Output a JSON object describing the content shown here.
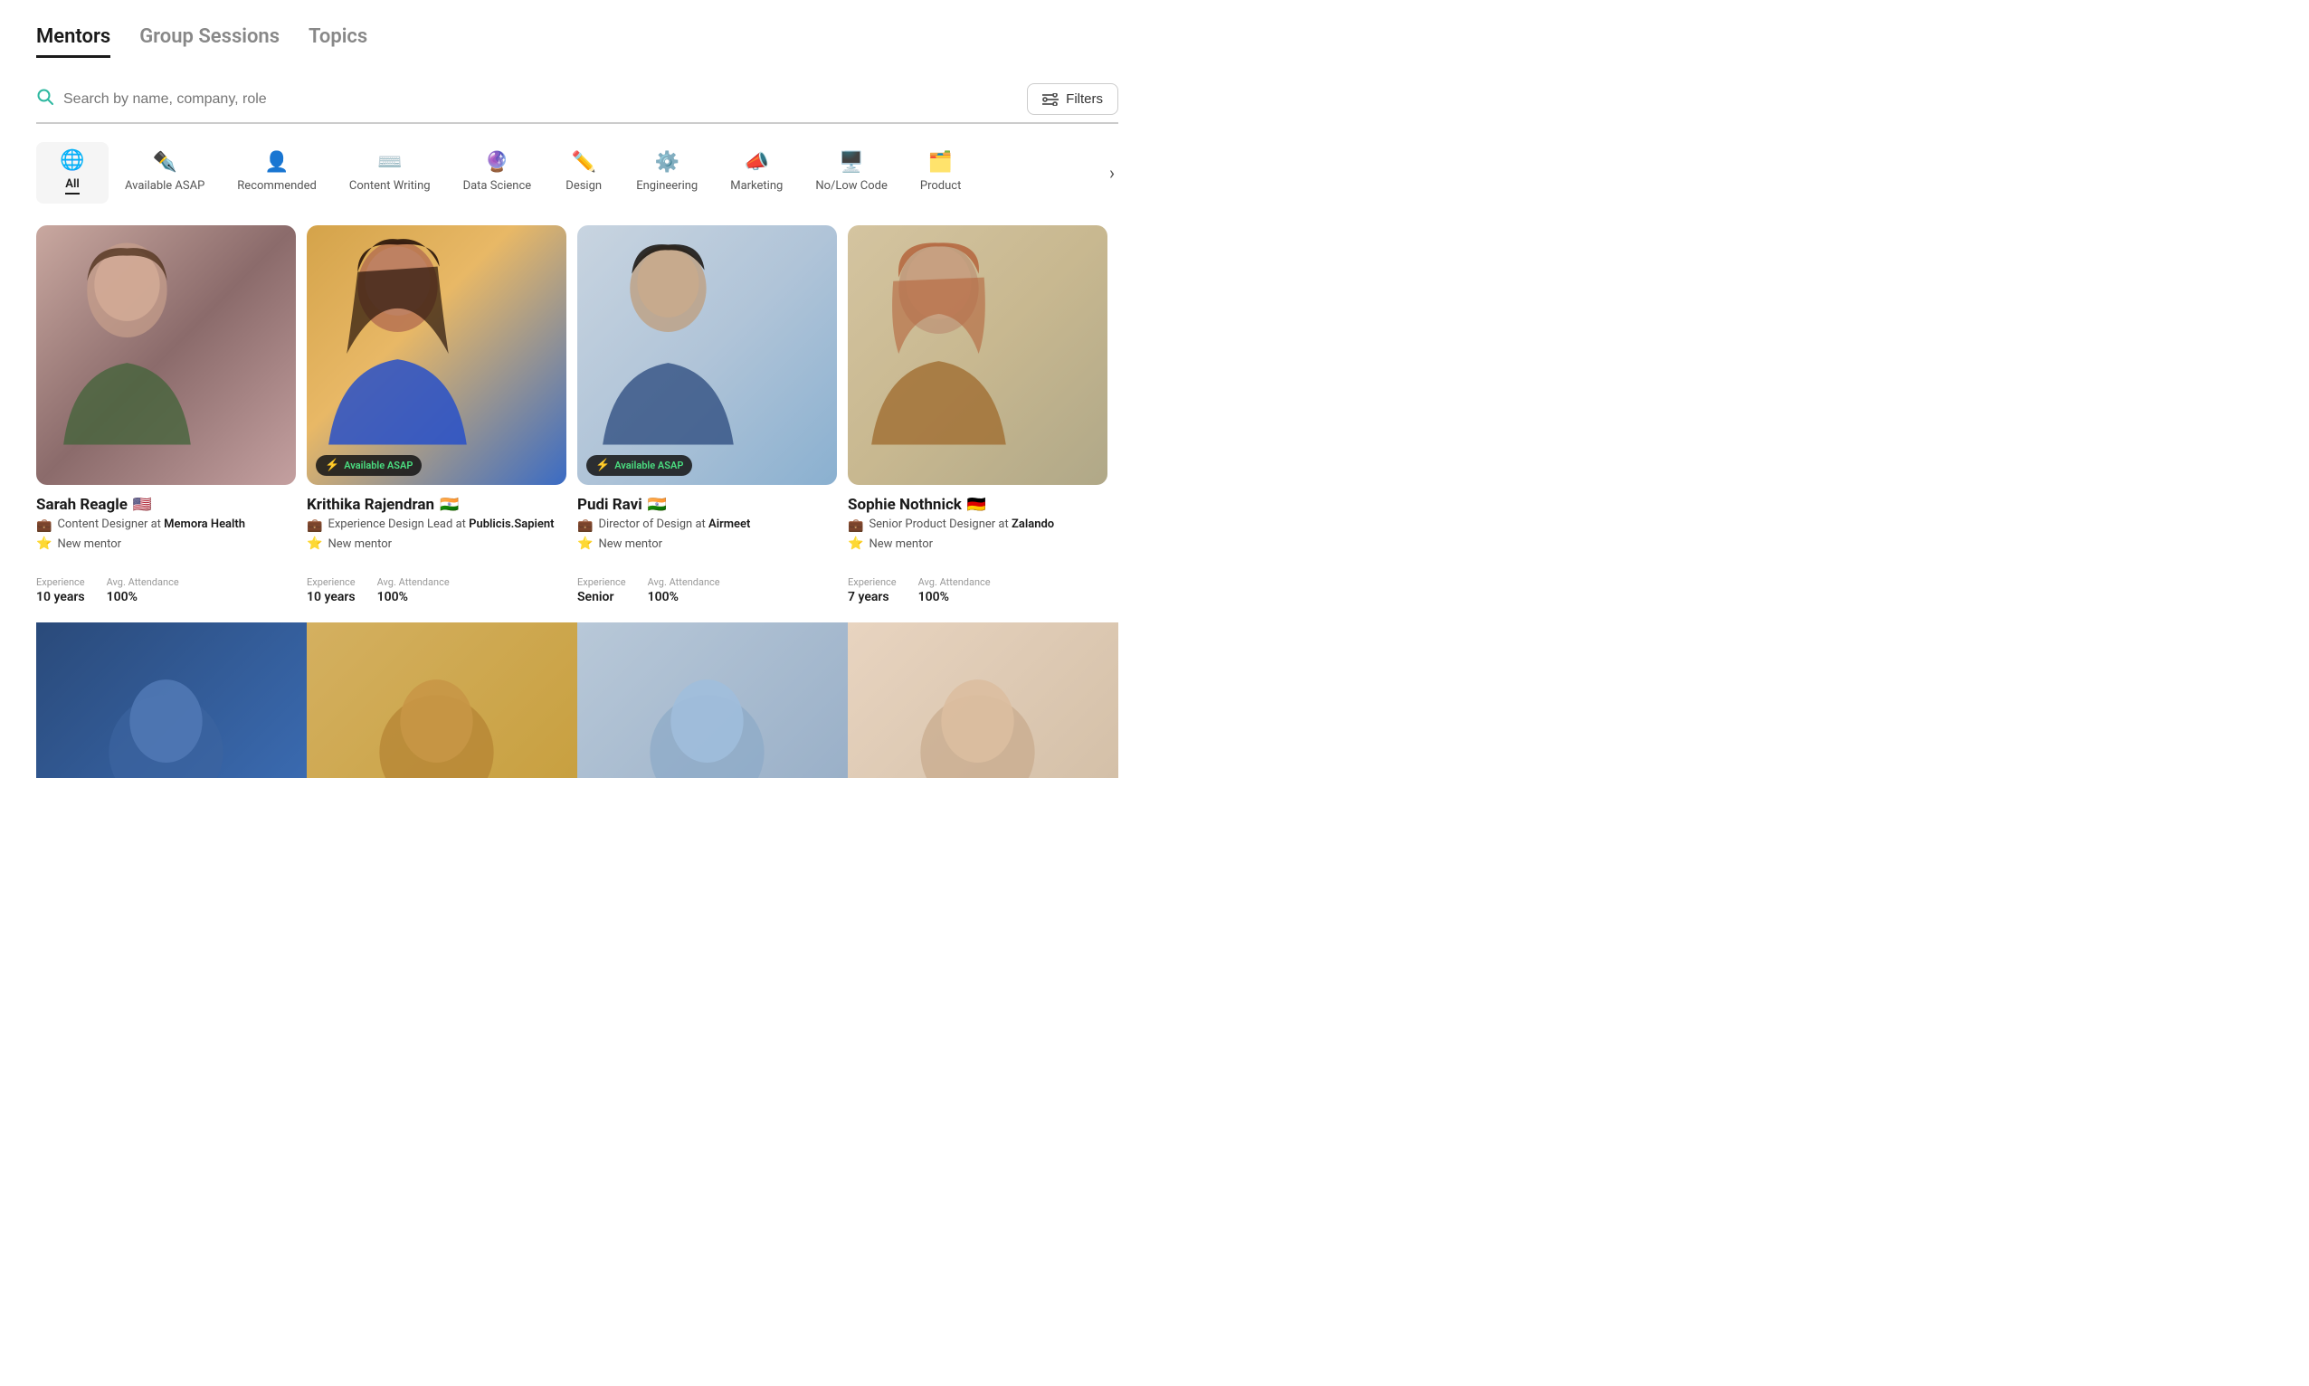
{
  "nav": {
    "tabs": [
      {
        "id": "mentors",
        "label": "Mentors",
        "active": true
      },
      {
        "id": "group-sessions",
        "label": "Group Sessions",
        "active": false
      },
      {
        "id": "topics",
        "label": "Topics",
        "active": false
      }
    ]
  },
  "search": {
    "placeholder": "Search by name, company, role",
    "filters_label": "Filters"
  },
  "categories": [
    {
      "id": "all",
      "label": "All",
      "icon": "🌐",
      "active": true
    },
    {
      "id": "available-asap",
      "label": "Available ASAP",
      "icon": "🖊️",
      "active": false
    },
    {
      "id": "recommended",
      "label": "Recommended",
      "icon": "👤",
      "active": false
    },
    {
      "id": "content-writing",
      "label": "Content Writing",
      "icon": "⌨️",
      "active": false
    },
    {
      "id": "data-science",
      "label": "Data Science",
      "icon": "🔮",
      "active": false
    },
    {
      "id": "design",
      "label": "Design",
      "icon": "✏️",
      "active": false
    },
    {
      "id": "engineering",
      "label": "Engineering",
      "icon": "⚙️",
      "active": false
    },
    {
      "id": "marketing",
      "label": "Marketing",
      "icon": "📣",
      "active": false
    },
    {
      "id": "no-low-code",
      "label": "No/Low Code",
      "icon": "🖥️",
      "active": false
    },
    {
      "id": "product",
      "label": "Product",
      "icon": "🗂️",
      "active": false
    }
  ],
  "mentors": [
    {
      "name": "Sarah Reagle",
      "flag": "🇺🇸",
      "role": "Content Designer",
      "at": "at",
      "company": "Memora Health",
      "badge": "New mentor",
      "available_asap": false,
      "experience": "10 years",
      "avg_attendance": "100%",
      "photo_class": "photo-sarah"
    },
    {
      "name": "Krithika Rajendran",
      "flag": "🇮🇳",
      "role": "Experience Design Lead",
      "at": "at",
      "company": "Publicis.Sapient",
      "badge": "New mentor",
      "available_asap": true,
      "experience": "10 years",
      "avg_attendance": "100%",
      "photo_class": "photo-krithika"
    },
    {
      "name": "Pudi Ravi",
      "flag": "🇮🇳",
      "role": "Director of Design",
      "at": "at",
      "company": "Airmeet",
      "badge": "New mentor",
      "available_asap": true,
      "experience": "Senior",
      "avg_attendance": "100%",
      "photo_class": "photo-pudi"
    },
    {
      "name": "Sophie Nothnick",
      "flag": "🇩🇪",
      "role": "Senior Product Designer",
      "at": "at",
      "company": "Zalando",
      "badge": "New mentor",
      "available_asap": false,
      "experience": "7 years",
      "avg_attendance": "100%",
      "photo_class": "photo-sophie"
    }
  ],
  "labels": {
    "experience": "Experience",
    "avg_attendance": "Avg. Attendance",
    "available_asap": "Available ASAP",
    "new_mentor": "New mentor"
  }
}
